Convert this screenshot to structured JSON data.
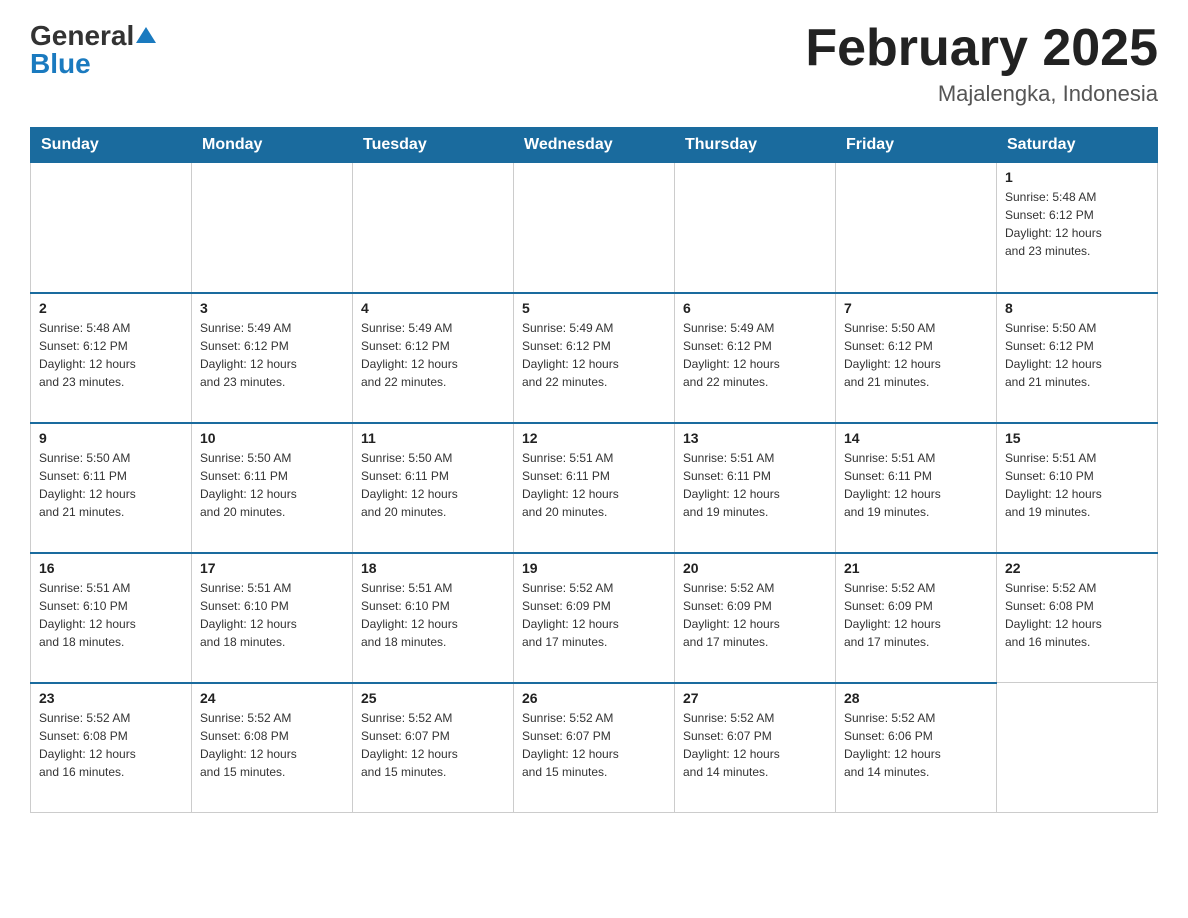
{
  "header": {
    "logo_general": "General",
    "logo_blue": "Blue",
    "month_title": "February 2025",
    "location": "Majalengka, Indonesia"
  },
  "days_of_week": [
    "Sunday",
    "Monday",
    "Tuesday",
    "Wednesday",
    "Thursday",
    "Friday",
    "Saturday"
  ],
  "weeks": [
    [
      {
        "day": "",
        "info": ""
      },
      {
        "day": "",
        "info": ""
      },
      {
        "day": "",
        "info": ""
      },
      {
        "day": "",
        "info": ""
      },
      {
        "day": "",
        "info": ""
      },
      {
        "day": "",
        "info": ""
      },
      {
        "day": "1",
        "info": "Sunrise: 5:48 AM\nSunset: 6:12 PM\nDaylight: 12 hours\nand 23 minutes."
      }
    ],
    [
      {
        "day": "2",
        "info": "Sunrise: 5:48 AM\nSunset: 6:12 PM\nDaylight: 12 hours\nand 23 minutes."
      },
      {
        "day": "3",
        "info": "Sunrise: 5:49 AM\nSunset: 6:12 PM\nDaylight: 12 hours\nand 23 minutes."
      },
      {
        "day": "4",
        "info": "Sunrise: 5:49 AM\nSunset: 6:12 PM\nDaylight: 12 hours\nand 22 minutes."
      },
      {
        "day": "5",
        "info": "Sunrise: 5:49 AM\nSunset: 6:12 PM\nDaylight: 12 hours\nand 22 minutes."
      },
      {
        "day": "6",
        "info": "Sunrise: 5:49 AM\nSunset: 6:12 PM\nDaylight: 12 hours\nand 22 minutes."
      },
      {
        "day": "7",
        "info": "Sunrise: 5:50 AM\nSunset: 6:12 PM\nDaylight: 12 hours\nand 21 minutes."
      },
      {
        "day": "8",
        "info": "Sunrise: 5:50 AM\nSunset: 6:12 PM\nDaylight: 12 hours\nand 21 minutes."
      }
    ],
    [
      {
        "day": "9",
        "info": "Sunrise: 5:50 AM\nSunset: 6:11 PM\nDaylight: 12 hours\nand 21 minutes."
      },
      {
        "day": "10",
        "info": "Sunrise: 5:50 AM\nSunset: 6:11 PM\nDaylight: 12 hours\nand 20 minutes."
      },
      {
        "day": "11",
        "info": "Sunrise: 5:50 AM\nSunset: 6:11 PM\nDaylight: 12 hours\nand 20 minutes."
      },
      {
        "day": "12",
        "info": "Sunrise: 5:51 AM\nSunset: 6:11 PM\nDaylight: 12 hours\nand 20 minutes."
      },
      {
        "day": "13",
        "info": "Sunrise: 5:51 AM\nSunset: 6:11 PM\nDaylight: 12 hours\nand 19 minutes."
      },
      {
        "day": "14",
        "info": "Sunrise: 5:51 AM\nSunset: 6:11 PM\nDaylight: 12 hours\nand 19 minutes."
      },
      {
        "day": "15",
        "info": "Sunrise: 5:51 AM\nSunset: 6:10 PM\nDaylight: 12 hours\nand 19 minutes."
      }
    ],
    [
      {
        "day": "16",
        "info": "Sunrise: 5:51 AM\nSunset: 6:10 PM\nDaylight: 12 hours\nand 18 minutes."
      },
      {
        "day": "17",
        "info": "Sunrise: 5:51 AM\nSunset: 6:10 PM\nDaylight: 12 hours\nand 18 minutes."
      },
      {
        "day": "18",
        "info": "Sunrise: 5:51 AM\nSunset: 6:10 PM\nDaylight: 12 hours\nand 18 minutes."
      },
      {
        "day": "19",
        "info": "Sunrise: 5:52 AM\nSunset: 6:09 PM\nDaylight: 12 hours\nand 17 minutes."
      },
      {
        "day": "20",
        "info": "Sunrise: 5:52 AM\nSunset: 6:09 PM\nDaylight: 12 hours\nand 17 minutes."
      },
      {
        "day": "21",
        "info": "Sunrise: 5:52 AM\nSunset: 6:09 PM\nDaylight: 12 hours\nand 17 minutes."
      },
      {
        "day": "22",
        "info": "Sunrise: 5:52 AM\nSunset: 6:08 PM\nDaylight: 12 hours\nand 16 minutes."
      }
    ],
    [
      {
        "day": "23",
        "info": "Sunrise: 5:52 AM\nSunset: 6:08 PM\nDaylight: 12 hours\nand 16 minutes."
      },
      {
        "day": "24",
        "info": "Sunrise: 5:52 AM\nSunset: 6:08 PM\nDaylight: 12 hours\nand 15 minutes."
      },
      {
        "day": "25",
        "info": "Sunrise: 5:52 AM\nSunset: 6:07 PM\nDaylight: 12 hours\nand 15 minutes."
      },
      {
        "day": "26",
        "info": "Sunrise: 5:52 AM\nSunset: 6:07 PM\nDaylight: 12 hours\nand 15 minutes."
      },
      {
        "day": "27",
        "info": "Sunrise: 5:52 AM\nSunset: 6:07 PM\nDaylight: 12 hours\nand 14 minutes."
      },
      {
        "day": "28",
        "info": "Sunrise: 5:52 AM\nSunset: 6:06 PM\nDaylight: 12 hours\nand 14 minutes."
      },
      {
        "day": "",
        "info": ""
      }
    ]
  ]
}
